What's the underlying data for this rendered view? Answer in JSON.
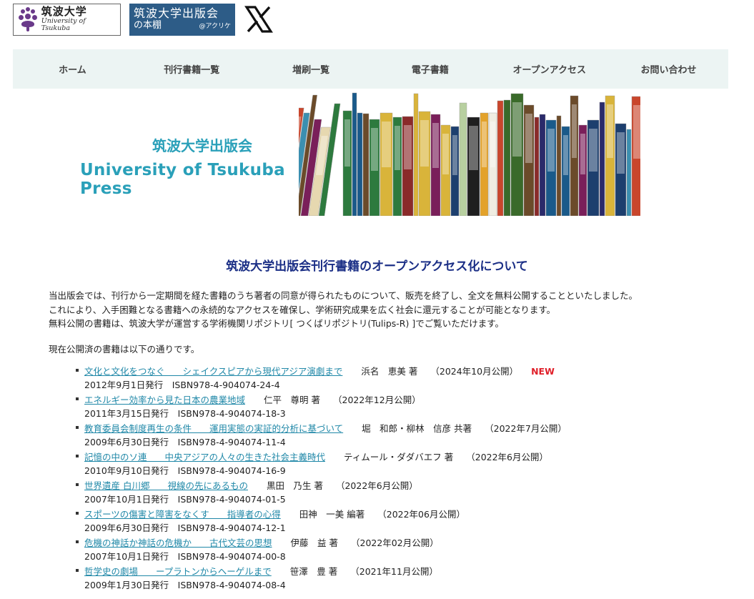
{
  "header": {
    "univ_logo_jp": "筑波大学",
    "univ_logo_en": "University of Tsukuba",
    "press_logo_line1": "筑波大学出版会",
    "press_logo_line2": "の本棚",
    "press_logo_handle": "@アクリケ",
    "social_icon": "x-logo-icon"
  },
  "nav": {
    "items": [
      "ホーム",
      "刊行書籍一覧",
      "増刷一覧",
      "電子書籍",
      "オープンアクセス",
      "お問い合わせ"
    ]
  },
  "hero": {
    "title_jp": "筑波大学出版会",
    "title_en": "University of Tsukuba Press"
  },
  "main": {
    "heading": "筑波大学出版会刊行書籍のオープンアクセス化について",
    "intro_lines": [
      "当出版会では、刊行から一定期間を経た書籍のうち著者の同意が得られたものについて、販売を終了し、全文を無料公開することといたしました。",
      "これにより、入手困難となる書籍への永続的なアクセスを確保し、学術研究成果を広く社会に還元することが可能となります。",
      "無料公開の書籍は、筑波大学が運営する学術機関リポジトリ[ つくばリポジトリ(Tulips-R) ]でご覧いただけます。"
    ],
    "current_label": "現在公開済の書籍は以下の通りです。",
    "books": [
      {
        "title": "文化と文化をつなぐ　　シェイクスピアから現代アジア演劇まで",
        "author": "浜名　恵美 著",
        "published": "（2024年10月公開）",
        "badge": "NEW",
        "info": "2012年9月1日発行　ISBN978-4-904074-24-4"
      },
      {
        "title": "エネルギー効率から見た日本の農業地域",
        "author": "仁平　尊明 著",
        "published": "（2022年12月公開）",
        "badge": "",
        "info": "2011年3月15日発行　ISBN978-4-904074-18-3"
      },
      {
        "title": "教育委員会制度再生の条件　　運用実態の実証的分析に基づいて",
        "author": "堀　和郎・柳林　信彦 共著",
        "published": "（2022年7月公開）",
        "badge": "",
        "info": "2009年6月30日発行　ISBN978-4-904074-11-4"
      },
      {
        "title": "記憶の中のソ連　　中央アジアの人々の生きた社会主義時代",
        "author": "ティムール・ダダバエフ 著",
        "published": "（2022年6月公開）",
        "badge": "",
        "info": "2010年9月10日発行　ISBN978-4-904074-16-9"
      },
      {
        "title": "世界遺産 白川郷　　視線の先にあるもの",
        "author": "黒田　乃生 著",
        "published": "（2022年6月公開）",
        "badge": "",
        "info": "2007年10月1日発行　ISBN978-4-904074-01-5"
      },
      {
        "title": "スポーツの傷害と障害をなくす　　指導者の心得",
        "author": "田神　一美 編著",
        "published": "（2022年06月公開）",
        "badge": "",
        "info": "2009年6月30日発行　ISBN978-4-904074-12-1"
      },
      {
        "title": "危機の神話か神話の危機か　　古代文芸の思想",
        "author": "伊藤　益 著",
        "published": "（2022年02月公開）",
        "badge": "",
        "info": "2007年10月1日発行　ISBN978-4-904074-00-8"
      },
      {
        "title": "哲学史の劇場　　ープラトンからヘーゲルまで",
        "author": "笹澤　豊 著",
        "published": "（2021年11月公開）",
        "badge": "",
        "info": "2009年1月30日発行　ISBN978-4-904074-08-4"
      }
    ]
  }
}
